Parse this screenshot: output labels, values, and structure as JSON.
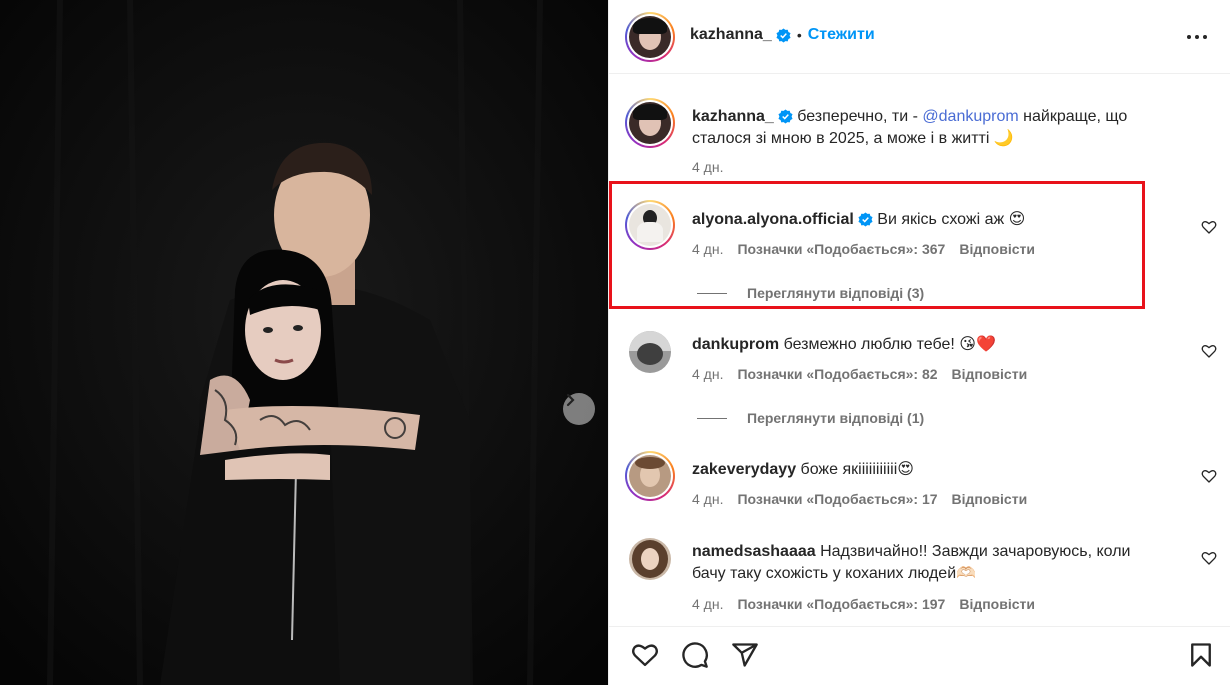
{
  "post": {
    "author": "kazhanna_",
    "follow_label": "Стежити",
    "separator": "•"
  },
  "caption": {
    "username": "kazhanna_",
    "text_before": "безперечно, ти - ",
    "mention": "@dankuprom",
    "text_after": " найкраще, що",
    "line2": "сталося зі мною в 2025, а може і в житті",
    "emoji": "🌙",
    "time": "4 дн."
  },
  "comments": [
    {
      "username": "alyona.alyona.official",
      "verified": true,
      "text": "Ви якісь схожі аж",
      "emoji": "😍",
      "time": "4 дн.",
      "likes": "Позначки «Подобається»: 367",
      "reply": "Відповісти",
      "view_replies": "Переглянути відповіді (3)"
    },
    {
      "username": "dankuprom",
      "verified": false,
      "text": "безмежно люблю тебе!",
      "emoji": "😘❤️",
      "time": "4 дн.",
      "likes": "Позначки «Подобається»: 82",
      "reply": "Відповісти",
      "view_replies": "Переглянути відповіді (1)"
    },
    {
      "username": "zakeverydayy",
      "verified": false,
      "text": "боже якііііііііііі",
      "emoji": "😍",
      "time": "4 дн.",
      "likes": "Позначки «Подобається»: 17",
      "reply": "Відповісти"
    },
    {
      "username": "namedsashaaaa",
      "verified": false,
      "text": "Надзвичайно!! Завжди зачаровуюсь, коли",
      "line2": "бачу таку схожість у коханих людей",
      "emoji": "🫶🏻",
      "time": "4 дн.",
      "likes": "Позначки «Подобається»: 197",
      "reply": "Відповісти"
    }
  ],
  "colors": {
    "accent": "#0095f6",
    "highlight": "#e8121a",
    "meta": "#737373",
    "mention": "#4a6cd4"
  },
  "icons": [
    "more-icon",
    "verified-icon",
    "heart-icon",
    "comment-icon",
    "share-icon",
    "bookmark-icon",
    "chevron-right-icon"
  ]
}
